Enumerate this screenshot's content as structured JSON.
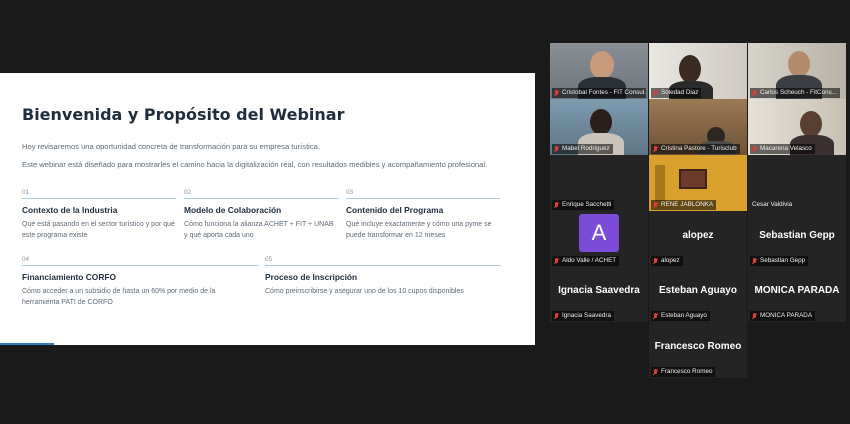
{
  "slide": {
    "title": "Bienvenida y Propósito del Webinar",
    "intro_1": "Hoy revisaremos una oportunidad concreta de transformación para su empresa turística.",
    "intro_2": "Este webinar está diseñado para mostrarles el camino hacia la digitalización real, con resultados medibles y acompañamiento profesional.",
    "topics": [
      {
        "num": "01",
        "title": "Contexto de la Industria",
        "desc": "Qué está pasando en el sector turístico y por qué este programa existe"
      },
      {
        "num": "02",
        "title": "Modelo de Colaboración",
        "desc": "Cómo funciona la alianza ACHET + FIT + UNAB y qué aporta cada uno"
      },
      {
        "num": "03",
        "title": "Contenido del Programa",
        "desc": "Qué incluye exactamente y cómo una pyme se puede transformar en 12 meses"
      },
      {
        "num": "04",
        "title": "Financiamiento CORFO",
        "desc": "Cómo acceder a un subsidio de hasta un 60% por medio de la herramienta PATI de CORFO"
      },
      {
        "num": "05",
        "title": "Proceso de Inscripción",
        "desc": "Cómo preinscribirse y asegurar uno de los 10 cupos disponibles"
      }
    ]
  },
  "participants": [
    {
      "name": "Cristobal Fontes - FIT Consul...",
      "video": true,
      "active": true
    },
    {
      "name": "Soledad Diaz",
      "video": true
    },
    {
      "name": "Carlos Scheuch - FitCons...",
      "video": true
    },
    {
      "name": "Mabel Rodriguez",
      "video": true
    },
    {
      "name": "Cristina Pastore - Turisclub",
      "video": true
    },
    {
      "name": "Macarena Velasco",
      "video": true
    },
    {
      "name": "Enrique Sacchetti",
      "video": false
    },
    {
      "name": "RENE JABLONKA",
      "video": true
    },
    {
      "name": "Cesar Valdivia",
      "video": false
    },
    {
      "name": "Aldo Valle / ACHET",
      "video": false,
      "avatar": "A"
    },
    {
      "name": "alopez",
      "video": false,
      "big_name": "alopez"
    },
    {
      "name": "Sebastian Gepp",
      "video": false,
      "big_name": "Sebastian Gepp"
    },
    {
      "name": "Ignacia Saavedra",
      "video": false,
      "big_name": "Ignacia Saavedra"
    },
    {
      "name": "Esteban Aguayo",
      "video": false,
      "big_name": "Esteban Aguayo"
    },
    {
      "name": "MONICA PARADA",
      "video": false,
      "big_name": "MONICA PARADA"
    },
    {
      "name": "Francesco Romeo",
      "video": false,
      "big_name": "Francesco Romeo"
    }
  ],
  "icons": {
    "mute": "microphone-muted-icon"
  },
  "colors": {
    "active_speaker": "#35d17a",
    "avatar_bg": "#7c4bd8",
    "mute": "#e23b3b"
  }
}
